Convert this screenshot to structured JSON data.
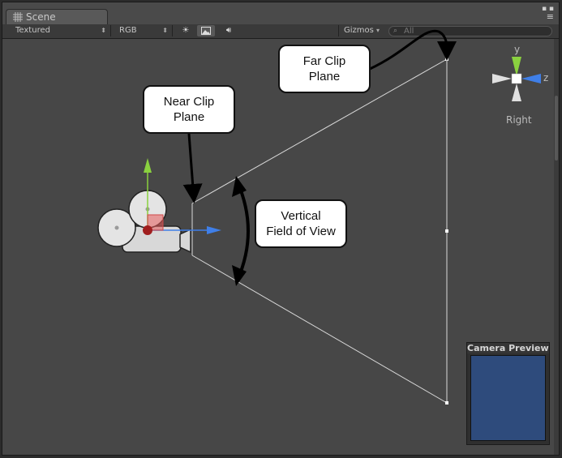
{
  "window": {
    "tab_title": "Scene",
    "controls": [
      "▪ ▪",
      "≡"
    ]
  },
  "toolbar": {
    "render_mode": "Textured",
    "color_mode": "RGB",
    "gizmos_label": "Gizmos",
    "search_placeholder": "All",
    "lighting_icon": "sun-icon",
    "image_icon": "image-icon",
    "audio_icon": "speaker-icon"
  },
  "callouts": {
    "far_clip": "Far Clip\nPlane",
    "near_clip": "Near Clip\nPlane",
    "fov": "Vertical\nField of View"
  },
  "orientation_gizmo": {
    "y_label": "y",
    "z_label": "z",
    "view_name": "Right"
  },
  "camera_preview": {
    "title": "Camera Preview"
  },
  "colors": {
    "viewport_bg": "#474747",
    "y_axis": "#8ad13f",
    "z_axis": "#3f7fe8",
    "preview_screen": "#2e4b7c"
  }
}
